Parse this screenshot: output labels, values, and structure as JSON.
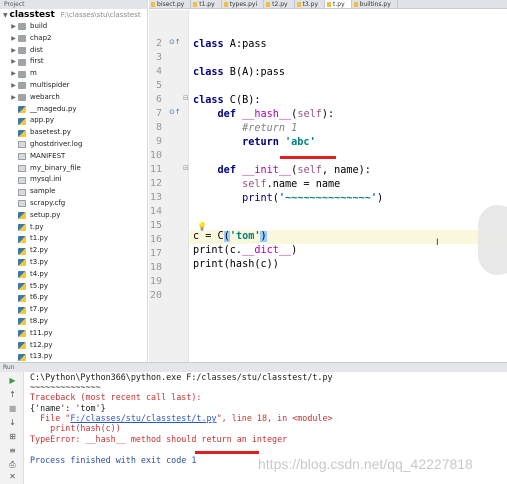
{
  "sidebar": {
    "header": "Project",
    "root_name": "classtest",
    "root_path": "F:\\classes\\stu\\classtest",
    "folders": [
      "build",
      "chap2",
      "dist",
      "first",
      "m",
      "multispider",
      "webarch"
    ],
    "files": [
      "__magedu.py",
      "app.py",
      "basetest.py",
      "ghostdriver.log",
      "MANIFEST",
      "my_binary_file",
      "mysql.ini",
      "sample",
      "scrapy.cfg",
      "setup.py",
      "t.py",
      "t1.py",
      "t2.py",
      "t3.py",
      "t4.py",
      "t5.py",
      "t6.py",
      "t7.py",
      "t8.py",
      "t11.py",
      "t12.py",
      "t13.py"
    ]
  },
  "tabs": [
    "bisect.py",
    "t1.py",
    "types.pyi",
    "t2.py",
    "t3.py",
    "t.py",
    "builtins.py"
  ],
  "active_tab": "t.py",
  "editor": {
    "line_numbers": [
      "2",
      "3",
      "4",
      "5",
      "6",
      "7",
      "8",
      "9",
      "10",
      "11",
      "12",
      "13",
      "14",
      "15",
      "16",
      "17",
      "18",
      "19",
      "20"
    ],
    "code": {
      "l2_kw": "class",
      "l2_rest": " A:pass",
      "l4_kw": "class",
      "l4_rest": " B(A):pass",
      "l6_kw": "class",
      "l6_rest": " C(B):",
      "l7_def": "def",
      "l7_magic": "__hash__",
      "l7_open": "(",
      "l7_self": "self",
      "l7_close": "):",
      "l8_comment": "#return 1",
      "l9_kw": "return",
      "l9_str": "'abc'",
      "l11_def": "def",
      "l11_magic": "__init__",
      "l11_open": "(",
      "l11_self": "self",
      "l11_rest": ", name):",
      "l12_self": "self",
      "l12_rest": ".name = name",
      "l13_builtin": "print",
      "l13_open": "(",
      "l13_str": "'~~~~~~~~~~~~~~'",
      "l13_close": ")",
      "l16_pre": "c = C",
      "l16_open": "(",
      "l16_str": "'tom'",
      "l16_close": ")",
      "l17_pre": "print(c.",
      "l17_magic": "__dict__",
      "l17_close": ")",
      "l18": "print(hash(c))"
    }
  },
  "run_panel": {
    "tab_label": "Run",
    "lines": {
      "cmd": "C:\\Python\\Python366\\python.exe F:/classes/stu/classtest/t.py",
      "tilde": "~~~~~~~~~~~~~~",
      "traceback": "Traceback (most recent call last):",
      "dict": "{'name': 'tom'}",
      "file_pre": "  File \"",
      "file_link": "F:/classes/stu/classtest/t.py",
      "file_post": "\", line 18, in <module>",
      "code": "    print(hash(c))",
      "error": "TypeError: __hash__ method should return an integer",
      "finished": "Process finished with exit code 1"
    }
  },
  "watermark": "https://blog.csdn.net/qq_42227818",
  "colors": {
    "keyword": "#000080",
    "magic": "#b200b2",
    "string": "#008080",
    "comment": "#808080",
    "underline_red": "#e02020",
    "highlight_line": "#fbf7dc",
    "error_text": "#c83232"
  }
}
